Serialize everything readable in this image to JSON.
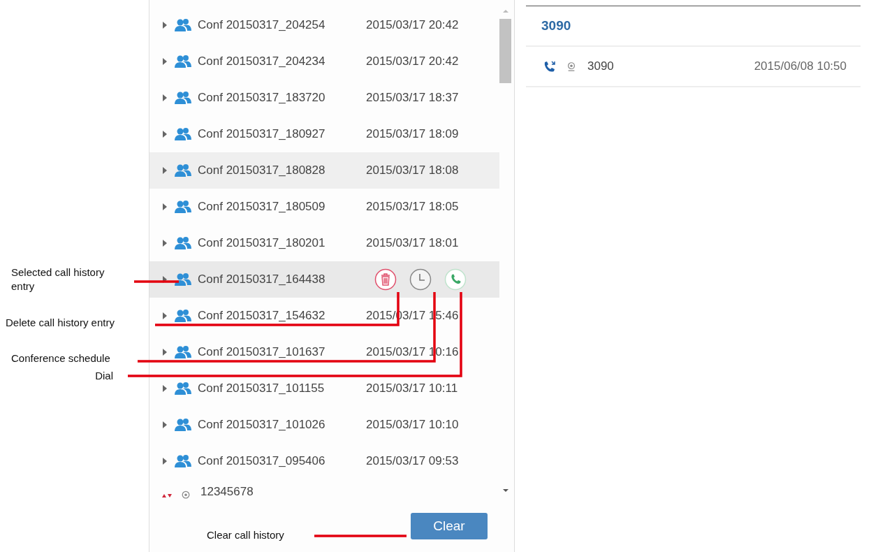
{
  "call_list": {
    "rows": [
      {
        "kind": "conference",
        "name": "Conf 20150317_204254",
        "time": "2015/03/17 20:42",
        "selected": false,
        "hovered": false
      },
      {
        "kind": "conference",
        "name": "Conf 20150317_204234",
        "time": "2015/03/17 20:42",
        "selected": false,
        "hovered": false
      },
      {
        "kind": "conference",
        "name": "Conf 20150317_183720",
        "time": "2015/03/17 18:37",
        "selected": false,
        "hovered": false
      },
      {
        "kind": "conference",
        "name": "Conf 20150317_180927",
        "time": "2015/03/17 18:09",
        "selected": false,
        "hovered": false
      },
      {
        "kind": "conference",
        "name": "Conf 20150317_180828",
        "time": "2015/03/17 18:08",
        "selected": false,
        "hovered": true
      },
      {
        "kind": "conference",
        "name": "Conf 20150317_180509",
        "time": "2015/03/17 18:05",
        "selected": false,
        "hovered": false
      },
      {
        "kind": "conference",
        "name": "Conf 20150317_180201",
        "time": "2015/03/17 18:01",
        "selected": false,
        "hovered": false
      },
      {
        "kind": "conference",
        "name": "Conf 20150317_164438",
        "selected": true,
        "hovered": false,
        "actions": [
          {
            "kind": "delete"
          },
          {
            "kind": "schedule"
          },
          {
            "kind": "dial"
          }
        ]
      },
      {
        "kind": "conference",
        "name": "Conf 20150317_154632",
        "time": "2015/03/17 15:46",
        "selected": false,
        "hovered": false
      },
      {
        "kind": "conference",
        "name": "Conf 20150317_101637",
        "time": "2015/03/17 10:16",
        "selected": false,
        "hovered": false
      },
      {
        "kind": "conference",
        "name": "Conf 20150317_101155",
        "time": "2015/03/17 10:11",
        "selected": false,
        "hovered": false
      },
      {
        "kind": "conference",
        "name": "Conf 20150317_101026",
        "time": "2015/03/17 10:10",
        "selected": false,
        "hovered": false
      },
      {
        "kind": "conference",
        "name": "Conf 20150317_095406",
        "time": "2015/03/17 09:53",
        "selected": false,
        "hovered": false
      },
      {
        "kind": "call",
        "name": "12345678",
        "selected": false,
        "hovered": false
      }
    ],
    "clear_button": "Clear"
  },
  "detail": {
    "title": "3090",
    "entries": [
      {
        "number": "3090",
        "time": "2015/06/08 10:50"
      }
    ]
  },
  "annotations": [
    {
      "kind": "selected-entry",
      "text": "Selected call history entry"
    },
    {
      "kind": "delete",
      "text": "Delete call history entry"
    },
    {
      "kind": "schedule",
      "text": "Conference schedule"
    },
    {
      "kind": "dial",
      "text": "Dial"
    },
    {
      "kind": "clear",
      "text": "Clear call history"
    }
  ]
}
